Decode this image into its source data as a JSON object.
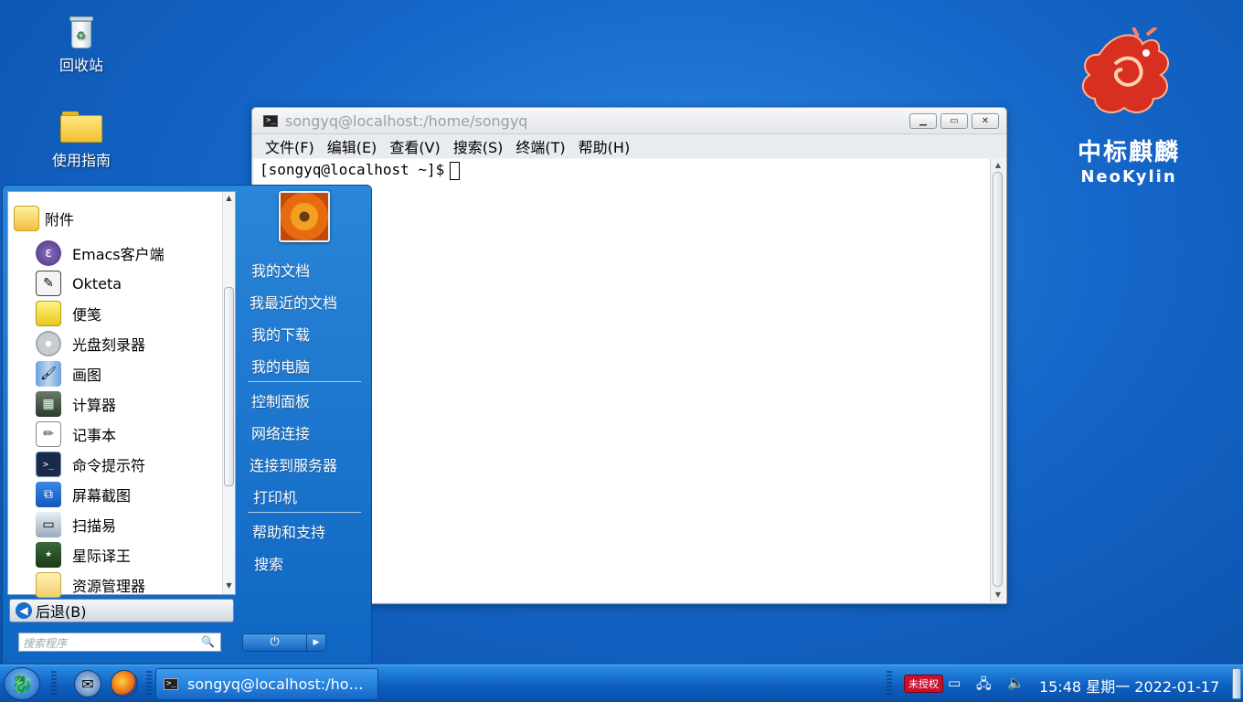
{
  "desktop": {
    "icons": [
      {
        "label": "回收站"
      },
      {
        "label": "使用指南"
      }
    ],
    "logo": {
      "cn": "中标麒麟",
      "en": "NeoKylin"
    }
  },
  "terminal": {
    "title": "songyq@localhost:/home/songyq",
    "menu": [
      "文件(F)",
      "编辑(E)",
      "查看(V)",
      "搜索(S)",
      "终端(T)",
      "帮助(H)"
    ],
    "prompt": "[songyq@localhost ~]$"
  },
  "start_menu": {
    "category": "附件",
    "apps": [
      "Emacs客户端",
      "Okteta",
      "便笺",
      "光盘刻录器",
      "画图",
      "计算器",
      "记事本",
      "命令提示符",
      "屏幕截图",
      "扫描易",
      "星际译王",
      "资源管理器"
    ],
    "back_label": "后退(B)",
    "search_placeholder": "搜索程序",
    "places_group1": [
      "我的文档",
      "我最近的文档",
      "我的下载",
      "我的电脑"
    ],
    "places_group2": [
      "控制面板",
      "网络连接",
      "连接到服务器",
      "打印机"
    ],
    "places_group3": [
      "帮助和支持",
      "搜索"
    ]
  },
  "taskbar": {
    "task_title": "songyq@localhost:/ho…",
    "tray_badge": "未授权",
    "clock": "15:48 星期一 2022-01-17"
  }
}
